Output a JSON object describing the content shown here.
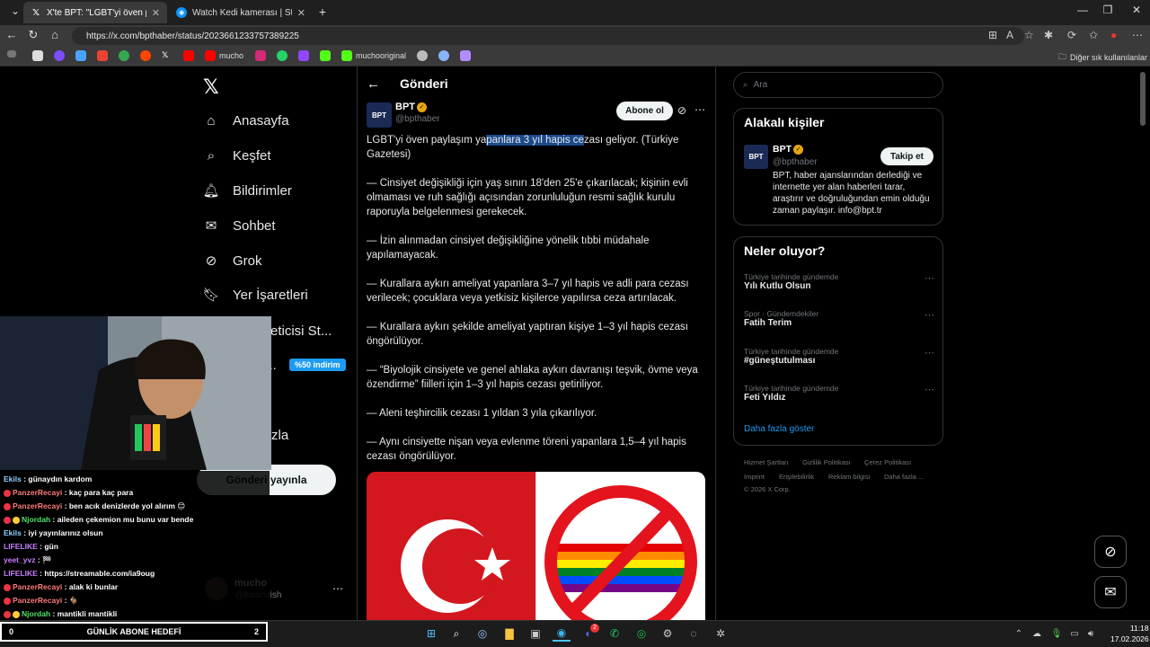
{
  "browser": {
    "tabs": [
      {
        "label": "X'te BPT: \"LGBT'yi öven paylaşım ya",
        "favicon": "x-icon"
      },
      {
        "label": "Watch Kedi kamerası | Streamable",
        "favicon": "streamable-icon"
      }
    ],
    "url": "https://x.com/bpthaber/status/2023661233757389225",
    "bookmarks": [
      "mucho",
      "muchooriginal"
    ],
    "other_bookmarks": "Diğer sık kullanılanlar"
  },
  "nav": {
    "items": [
      "Anasayfa",
      "Keşfet",
      "Bildirimler",
      "Sohbet",
      "Grok",
      "Yer İşaretleri"
    ],
    "partial_creator": "reticisi St...",
    "partial_more": "zla",
    "premium_badge": "%50 indirim",
    "post_button": "Gönderi yayınla",
    "profile_name": "mucho",
    "profile_handle": "@lkeanirish"
  },
  "post": {
    "page_title": "Gönderi",
    "author_name": "BPT",
    "author_handle": "@bpthaber",
    "avatar_text": "BPT",
    "subscribe": "Abone ol",
    "lead_pre": "LGBT'yi öven paylaşım ya",
    "lead_hl": "panlara 3 yıl hapis ce",
    "lead_post": "zası geliyor. (Türkiye Gazetesi)",
    "paragraphs": [
      "— Cinsiyet değişikliği için yaş sınırı 18'den 25'e çıkarılacak; kişinin evli olmaması ve ruh sağlığı açısından zorunluluğun resmi sağlık kurulu raporuyla belgelenmesi gerekecek.",
      "— İzin alınmadan cinsiyet değişikliğine yönelik tıbbi müdahale yapılamayacak.",
      "— Kurallara aykırı ameliyat yapanlara 3–7 yıl hapis ve adli para cezası verilecek; çocuklara veya yetkisiz kişilerce yapılırsa ceza artırılacak.",
      "— Kurallara aykırı şekilde ameliyat yaptıran kişiye 1–3 yıl hapis cezası öngörülüyor.",
      "— “Biyolojik cinsiyete ve genel ahlaka aykırı davranışı teşvik, övme veya özendirme” fiilleri için 1–3 yıl hapis cezası getiriliyor.",
      "— Aleni teşhircilik cezası 1 yıldan 3 yıla çıkarılıyor.",
      "— Aynı cinsiyette nişan veya evlenme töreni yapanlara 1,5–4 yıl hapis cezası öngörülüyor."
    ]
  },
  "sidebar": {
    "search_placeholder": "Ara",
    "related_title": "Alakalı kişiler",
    "related_name": "BPT",
    "related_handle": "@bpthaber",
    "follow": "Takip et",
    "bio": "BPT, haber ajanslarından derlediği ve internette yer alan haberleri tarar, araştırır ve doğruluğundan emin olduğu zaman paylaşır. info@bpt.tr",
    "trends_title": "Neler oluyor?",
    "trends": [
      {
        "context": "Türkiye tarihinde gündemde",
        "name": "Yılı Kutlu Olsun"
      },
      {
        "context": "Spor · Gündemdekiler",
        "name": "Fatih Terim"
      },
      {
        "context": "Türkiye tarihinde gündemde",
        "name": "#güneştutulması"
      },
      {
        "context": "Türkiye tarihinde gündemde",
        "name": "Feti Yıldız"
      }
    ],
    "show_more": "Daha fazla göster",
    "footer": [
      "Hizmet Şartları",
      "Gizlilik Politikası",
      "Çerez Politikası",
      "Imprint",
      "Erişilebilirlik",
      "Reklam bilgisi",
      "Daha fazla ...",
      "© 2026 X Corp."
    ]
  },
  "chat": {
    "lines": [
      {
        "user": "Ekils",
        "color": "#8fd0ff",
        "msg": "günaydın kardom"
      },
      {
        "user": "PanzerRecayi",
        "color": "#ff7a7a",
        "msg": "kaç para kaç para"
      },
      {
        "user": "PanzerRecayi",
        "color": "#ff7a7a",
        "msg": "ben acık denizlerde yol alırım 😊"
      },
      {
        "user": "Njordah",
        "color": "#54e06a",
        "msg": "aileden çekemion mu bunu var bende"
      },
      {
        "user": "Ekils",
        "color": "#8fd0ff",
        "msg": "iyi yayınlarınız olsun"
      },
      {
        "user": "LIFELIKE",
        "color": "#c77dff",
        "msg": "gün"
      },
      {
        "user": "yeet_yvz",
        "color": "#c77dff",
        "msg": "🏁"
      },
      {
        "user": "LIFELIKE",
        "color": "#c77dff",
        "msg": "https://streamable.com/ia9oug"
      },
      {
        "user": "PanzerRecayi",
        "color": "#ff7a7a",
        "msg": "alak ki bunlar"
      },
      {
        "user": "PanzerRecayi",
        "color": "#ff7a7a",
        "msg": "🐐"
      },
      {
        "user": "Njordah",
        "color": "#54e06a",
        "msg": "mantikli mantikli"
      }
    ],
    "goal_left": "0",
    "goal_label": "GÜNLİK ABONE HEDEFİ",
    "goal_right": "2"
  },
  "taskbar": {
    "time": "11:18",
    "date": "17.02.2026",
    "discord_badge": "2"
  }
}
